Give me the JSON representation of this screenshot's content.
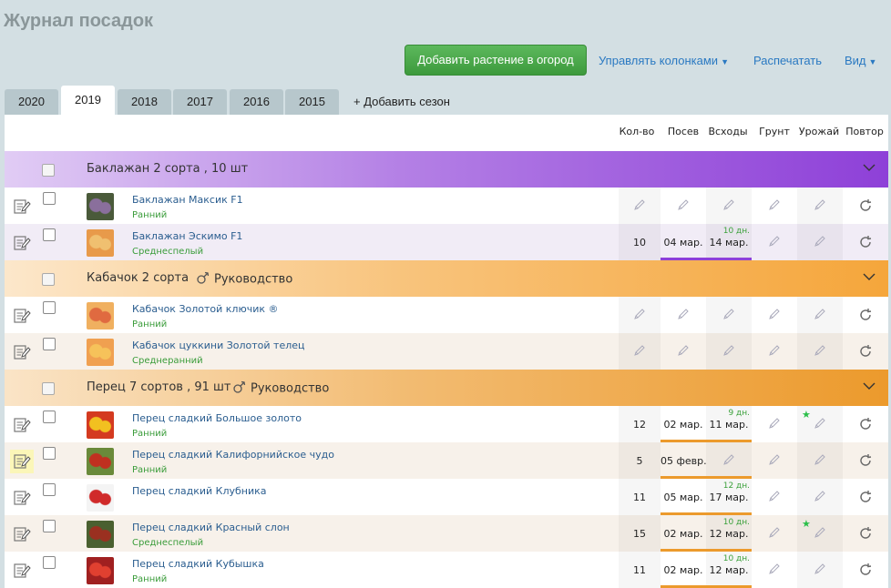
{
  "page": {
    "title": "Журнал посадок"
  },
  "toolbar": {
    "add_plant": "Добавить растение в огород",
    "manage_columns": "Управлять колонками",
    "print": "Распечатать",
    "view": "Вид"
  },
  "tabs": [
    "2020",
    "2019",
    "2018",
    "2017",
    "2016",
    "2015"
  ],
  "active_tab": "2019",
  "add_season": "+ Добавить сезон",
  "columns": [
    "Кол-во",
    "Посев",
    "Всходы",
    "Грунт",
    "Урожай",
    "Повтор"
  ],
  "groups": [
    {
      "title": "Баклажан 2 сорта , 10 шт",
      "guide": "",
      "color": "#8e40d8"
    },
    {
      "title": "Кабачок 2 сорта",
      "guide": "Руководство",
      "color": "#f5a63b"
    },
    {
      "title": "Перец 7 сортов , 91 шт",
      "guide": "Руководство",
      "color": "#ec9a2c"
    }
  ],
  "rows": [
    {
      "name": "Баклажан Максик F1",
      "type": "Ранний",
      "qty": "",
      "sow": "",
      "sprouts": "",
      "days": "",
      "star": false
    },
    {
      "name": "Баклажан Эскимо F1",
      "type": "Среднеспелый",
      "qty": "10",
      "sow": "04 мар.",
      "sprouts": "14 мар.",
      "days": "10 дн.",
      "star": false
    },
    {
      "name": "Кабачок Золотой ключик ®",
      "type": "Ранний",
      "qty": "",
      "sow": "",
      "sprouts": "",
      "days": "",
      "star": false
    },
    {
      "name": "Кабачок цуккини Золотой телец",
      "type": "Среднеранний",
      "qty": "",
      "sow": "",
      "sprouts": "",
      "days": "",
      "star": false
    },
    {
      "name": "Перец сладкий Большое золото",
      "type": "Ранний",
      "qty": "12",
      "sow": "02 мар.",
      "sprouts": "11 мар.",
      "days": "9 дн.",
      "star": true
    },
    {
      "name": "Перец сладкий Калифорнийское чудо",
      "type": "Ранний",
      "qty": "5",
      "sow": "05 февр.",
      "sprouts": "",
      "days": "",
      "star": false
    },
    {
      "name": "Перец сладкий Клубника",
      "type": "",
      "qty": "11",
      "sow": "05 мар.",
      "sprouts": "17 мар.",
      "days": "12 дн.",
      "star": false
    },
    {
      "name": "Перец сладкий Красный слон",
      "type": "Среднеспелый",
      "qty": "15",
      "sow": "02 мар.",
      "sprouts": "12 мар.",
      "days": "10 дн.",
      "star": true
    },
    {
      "name": "Перец сладкий Кубышка",
      "type": "Ранний",
      "qty": "11",
      "sow": "02 мар.",
      "sprouts": "12 мар.",
      "days": "10 дн.",
      "star": false
    }
  ],
  "colors": {
    "accent_green": "#4cae4c",
    "link_blue": "#2a79c2",
    "eggplant": "#8e40d8",
    "squash": "#f5a63b",
    "pepper": "#ec9a2c"
  },
  "icons": {
    "notes": "notes-icon",
    "edit": "pencil-icon",
    "repeat": "repeat-icon",
    "star": "star-icon",
    "guide": "guide-icon",
    "chevron": "chevron-down-icon"
  }
}
